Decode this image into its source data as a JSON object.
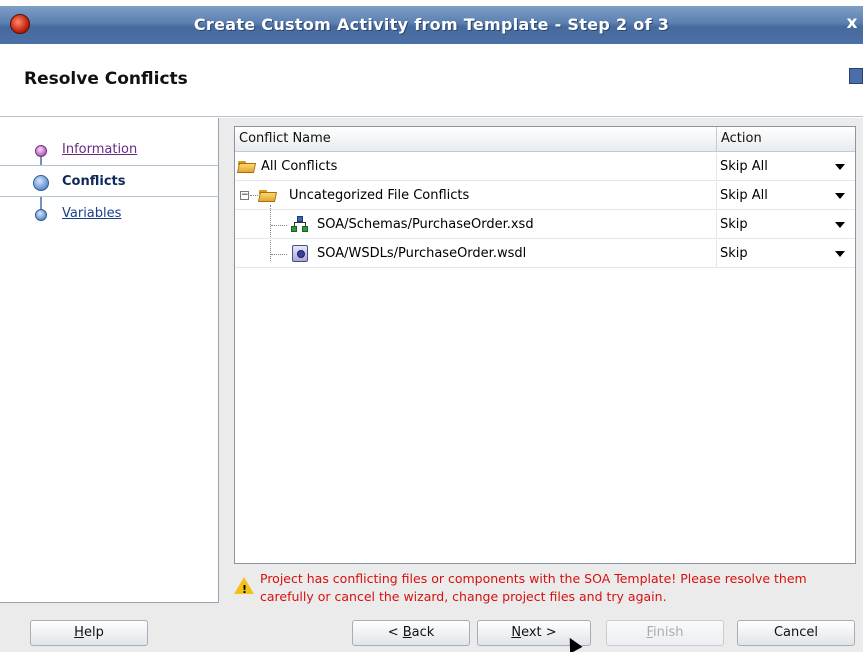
{
  "window": {
    "title": "Create Custom Activity from Template - Step 2 of 3",
    "close_glyph": "x"
  },
  "header": {
    "heading": "Resolve Conflicts"
  },
  "steps": [
    {
      "label": "Information",
      "state": "visited"
    },
    {
      "label": "Conflicts",
      "state": "current"
    },
    {
      "label": "Variables",
      "state": "pending"
    }
  ],
  "table": {
    "columns": [
      "Conflict Name",
      "Action"
    ],
    "rows": [
      {
        "name": "All Conflicts",
        "action": "Skip All",
        "icon": "folder-icon"
      },
      {
        "name": "Uncategorized File Conflicts",
        "action": "Skip All",
        "icon": "folder-icon"
      },
      {
        "name": "SOA/Schemas/PurchaseOrder.xsd",
        "action": "Skip",
        "icon": "xsd-schema-icon"
      },
      {
        "name": "SOA/WSDLs/PurchaseOrder.wsdl",
        "action": "Skip",
        "icon": "wsdl-icon"
      }
    ]
  },
  "warning": {
    "text": "Project has conflicting files or components with the SOA Template! Please resolve them carefully or cancel the wizard, change project files and try again."
  },
  "buttons": {
    "help": {
      "mnemonic": "H",
      "rest": "elp"
    },
    "back": {
      "prefix": "< ",
      "mnemonic": "B",
      "rest": "ack"
    },
    "next": {
      "mnemonic": "N",
      "rest": "ext >"
    },
    "finish": {
      "mnemonic": "F",
      "rest": "inish"
    },
    "cancel": "Cancel"
  },
  "colors": {
    "title_bar": "#5b7fb0",
    "warning_text": "#d81010",
    "link": "#1a3f8a"
  }
}
